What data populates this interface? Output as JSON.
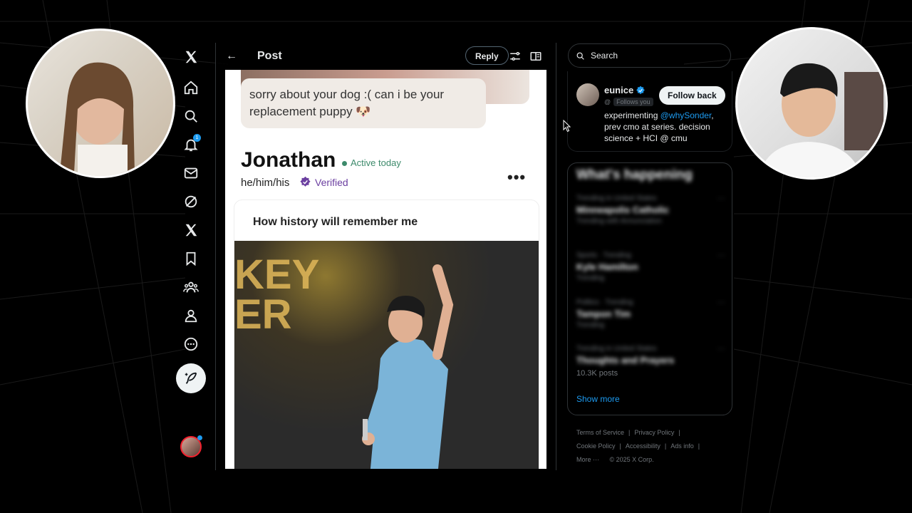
{
  "header": {
    "title": "Post",
    "reply_label": "Reply"
  },
  "nav": {
    "notification_count": "1"
  },
  "post": {
    "chat_message": "sorry about your dog :( can i be your replacement puppy 🐶",
    "profile_name": "Jonathan",
    "status": "Active today",
    "pronouns": "he/him/his",
    "verified_label": "Verified",
    "more_label": "•••",
    "prompt_title": "How history will remember me",
    "photo_text": "KEY\nER"
  },
  "search": {
    "placeholder": "Search"
  },
  "who_to_follow": {
    "name": "eunice",
    "handle_prefix": "@",
    "follows_you": "Follows you",
    "follow_label": "Follow back",
    "bio_before": "experimenting ",
    "bio_mention": "@whySonder",
    "bio_after": ", prev cmo at series. decision science + HCI @ cmu"
  },
  "trends": {
    "title": "What's happening",
    "items": [
      {
        "meta": "Trending in United States",
        "topic": "Minneapolis Catholic",
        "count": "Trending with Annunciation"
      },
      {
        "meta": "Sports · Trending",
        "topic": "Kyle Hamilton",
        "count": "Trending"
      },
      {
        "meta": "Politics · Trending",
        "topic": "Tampon Tim",
        "count": "Trending"
      },
      {
        "meta": "Trending in United States",
        "topic": "Thoughts and Prayers",
        "count": ""
      }
    ],
    "posts_count": "10.3K posts",
    "show_more": "Show more"
  },
  "footer": {
    "links": [
      "Terms of Service",
      "Privacy Policy",
      "Cookie Policy",
      "Accessibility",
      "Ads info"
    ],
    "more": "More ···",
    "copyright": "© 2025 X Corp."
  },
  "colors": {
    "accent": "#1d9bf0",
    "active_green": "#3d8a6b",
    "verified_purple": "#6b3fa0"
  }
}
